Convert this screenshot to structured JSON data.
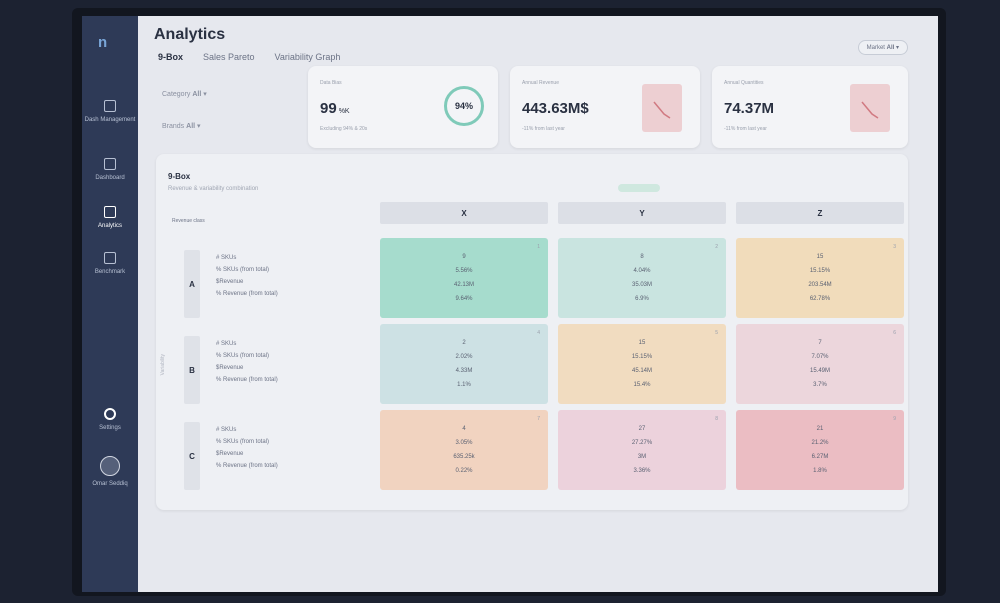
{
  "app": {
    "title": "Analytics"
  },
  "tabs": [
    {
      "label": "9-Box",
      "active": true
    },
    {
      "label": "Sales Pareto",
      "active": false
    },
    {
      "label": "Variability Graph",
      "active": false
    }
  ],
  "market": {
    "label": "Market",
    "value": "All"
  },
  "filters": {
    "category": {
      "label": "Category",
      "value": "All"
    },
    "brands": {
      "label": "Brands",
      "value": "All"
    }
  },
  "sidebar": {
    "items": [
      {
        "label": "Dash Management",
        "icon": "box-icon",
        "active": false
      },
      {
        "label": "Dashboard",
        "icon": "grid-icon",
        "active": false
      },
      {
        "label": "Analytics",
        "icon": "chart-icon",
        "active": true
      },
      {
        "label": "Benchmark",
        "icon": "bar-icon",
        "active": false
      }
    ],
    "settings": {
      "label": "Settings",
      "icon": "gear-icon"
    },
    "user": {
      "label": "Omar Seddiq",
      "icon": "avatar-icon"
    }
  },
  "cards": [
    {
      "label": "Data Bias",
      "value": "99",
      "unit": "%K",
      "sub": "Excluding 94% & 20s",
      "ring": "94%"
    },
    {
      "label": "Annual Revenue",
      "value": "443.63M$",
      "sub": "-11% from last year",
      "trend": "down"
    },
    {
      "label": "Annual Quantities",
      "value": "74.37M",
      "sub": "-11% from last year",
      "trend": "down"
    }
  ],
  "ninebox": {
    "title": "9-Box",
    "subtitle": "Revenue & variability combination",
    "legend_color": "#cfe8df",
    "y_title": "Revenue class",
    "x_title": "Variability",
    "columns": [
      "X",
      "Y",
      "Z"
    ],
    "rows": [
      {
        "letter": "A",
        "metrics": [
          "# SKUs",
          "% SKUs (from total)",
          "$Revenue",
          "% Revenue (from total)"
        ]
      },
      {
        "letter": "B",
        "metrics": [
          "# SKUs",
          "% SKUs (from total)",
          "$Revenue",
          "% Revenue (from total)"
        ]
      },
      {
        "letter": "C",
        "metrics": [
          "# SKUs",
          "% SKUs (from total)",
          "$Revenue",
          "% Revenue (from total)"
        ]
      }
    ],
    "cells": [
      {
        "num": "1",
        "color": "#a6dccd",
        "values": [
          "9",
          "5.56%",
          "42.13M",
          "9.64%"
        ]
      },
      {
        "num": "2",
        "color": "#c9e4e0",
        "values": [
          "8",
          "4.04%",
          "35.03M",
          "6.9%"
        ]
      },
      {
        "num": "3",
        "color": "#f1dcbb",
        "values": [
          "15",
          "15.15%",
          "203.54M",
          "62.78%"
        ]
      },
      {
        "num": "4",
        "color": "#cde1e4",
        "values": [
          "2",
          "2.02%",
          "4.33M",
          "1.1%"
        ]
      },
      {
        "num": "5",
        "color": "#f1dcc0",
        "values": [
          "15",
          "15.15%",
          "45.14M",
          "15.4%"
        ]
      },
      {
        "num": "6",
        "color": "#ecd6dc",
        "values": [
          "7",
          "7.07%",
          "15.49M",
          "3.7%"
        ]
      },
      {
        "num": "7",
        "color": "#f1d3c0",
        "values": [
          "4",
          "3.05%",
          "635.25k",
          "0.22%"
        ]
      },
      {
        "num": "8",
        "color": "#ecd2dc",
        "values": [
          "27",
          "27.27%",
          "3M",
          "3.36%"
        ]
      },
      {
        "num": "9",
        "color": "#ebbdc3",
        "values": [
          "21",
          "21.2%",
          "6.27M",
          "1.8%"
        ]
      }
    ]
  }
}
